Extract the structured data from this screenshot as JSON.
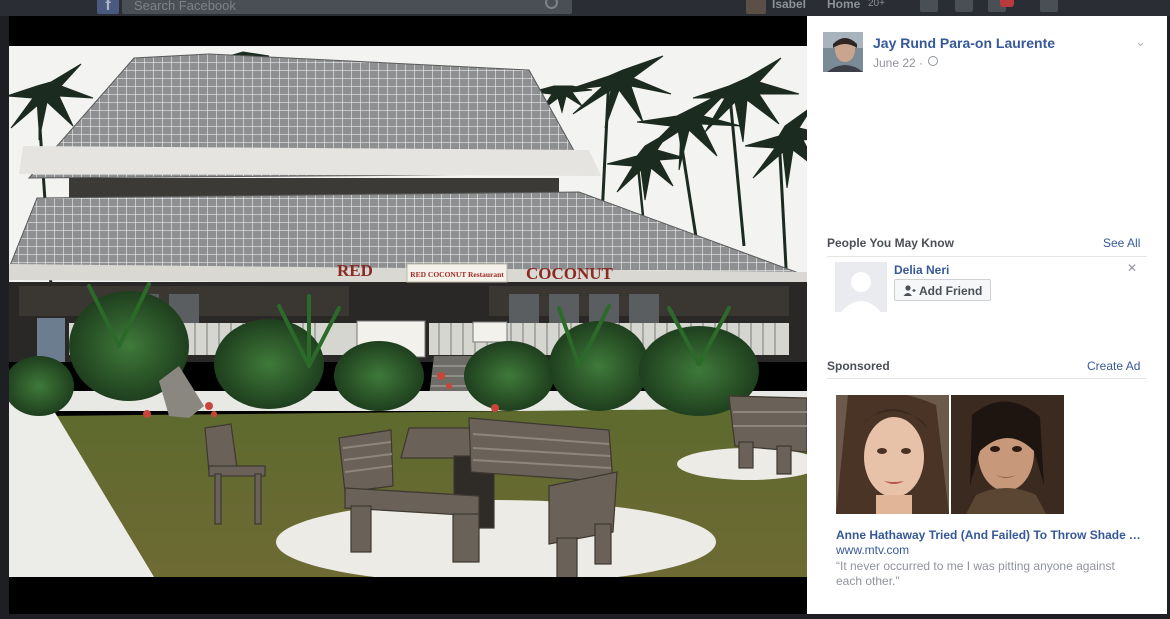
{
  "topbar": {
    "logo": "f",
    "search_placeholder": "Search Facebook",
    "user_name": "Isabel",
    "home_label": "Home",
    "home_count": "20+"
  },
  "icons": {
    "logo": "facebook-logo-icon",
    "search": "search-icon",
    "globe": "globe-icon",
    "chevron": "chevron-down-icon",
    "add_friend": "add-friend-icon",
    "close": "close-icon"
  },
  "post": {
    "author": "Jay Rund Para-on Laurente",
    "date": "June 22 ·",
    "photo_signs": {
      "sign_left": "RED",
      "sign_center": "RED COCONUT Restaurant",
      "sign_right": "COCONUT"
    }
  },
  "pymk": {
    "title": "People You May Know",
    "see_all": "See All",
    "items": [
      {
        "name": "Delia Neri",
        "button": "Add Friend"
      }
    ]
  },
  "sponsored": {
    "title": "Sponsored",
    "create_ad": "Create Ad",
    "ad": {
      "headline": "Anne Hathaway Tried (And Failed) To Throw Shade At Kim Kardashian",
      "domain": "www.mtv.com",
      "description": "“It never occurred to me I was pitting anyone against each other.”"
    }
  },
  "colors": {
    "link": "#365899",
    "muted": "#90949c",
    "overlay": "#1d1f23"
  }
}
